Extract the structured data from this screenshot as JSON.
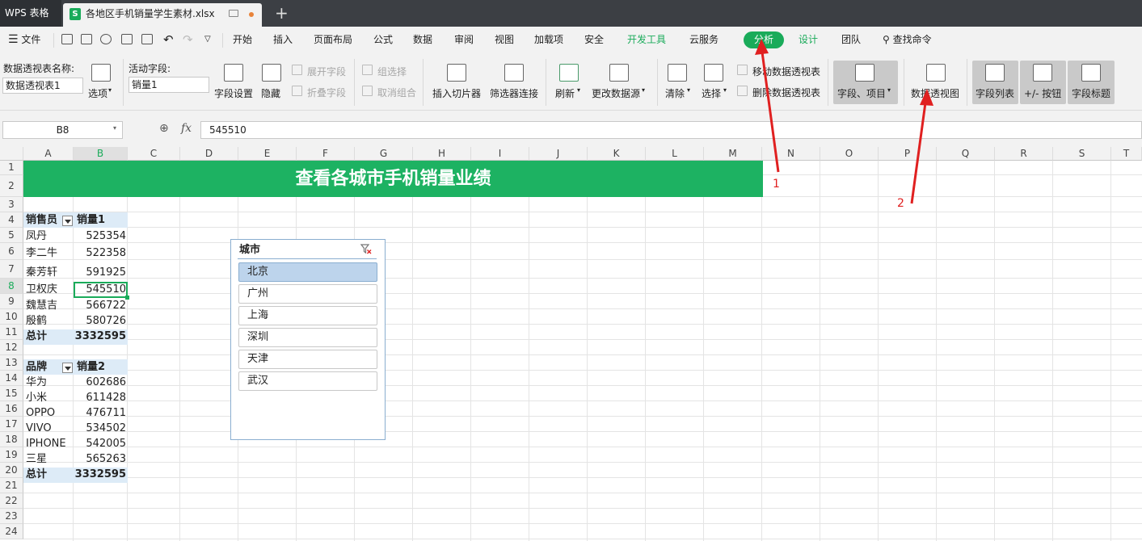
{
  "window": {
    "app_tab": "WPS 表格",
    "file_tab": "各地区手机销量学生素材.xlsx",
    "new_tab": "+"
  },
  "menu": {
    "file": "文件",
    "items": [
      "开始",
      "插入",
      "页面布局",
      "公式",
      "数据",
      "审阅",
      "视图",
      "加载项",
      "安全",
      "开发工具",
      "云服务",
      "分析",
      "设计",
      "团队"
    ],
    "active": "分析",
    "search": "查找命令"
  },
  "ribbon": {
    "pivot_name_label": "数据透视表名称:",
    "pivot_name_value": "数据透视表1",
    "options": "选项",
    "active_field_label": "活动字段:",
    "active_field_value": "销量1",
    "field_settings": "字段设置",
    "hide": "隐藏",
    "expand_field": "展开字段",
    "collapse_field": "折叠字段",
    "group_selection": "组选择",
    "ungroup": "取消组合",
    "insert_slicer": "插入切片器",
    "filter_connections": "筛选器连接",
    "refresh": "刷新",
    "change_source": "更改数据源",
    "clear": "清除",
    "select": "选择",
    "move_pivot": "移动数据透视表",
    "delete_pivot": "删除数据透视表",
    "fields_items": "字段、项目",
    "pivot_chart": "数据透视图",
    "field_list": "字段列表",
    "plus_minus_buttons": "+/- 按钮",
    "field_headers": "字段标题"
  },
  "formula_bar": {
    "name_box": "B8",
    "fx": "fx",
    "value": "545510"
  },
  "columns": [
    "A",
    "B",
    "C",
    "D",
    "E",
    "F",
    "G",
    "H",
    "I",
    "J",
    "K",
    "L",
    "M",
    "N",
    "O",
    "P",
    "Q",
    "R",
    "S",
    "T"
  ],
  "rows": [
    "1",
    "2",
    "3",
    "4",
    "5",
    "6",
    "7",
    "8",
    "9",
    "10",
    "11",
    "12",
    "13",
    "14",
    "15",
    "16",
    "17",
    "18",
    "19",
    "20",
    "21",
    "22",
    "23",
    "24"
  ],
  "sheet": {
    "title": "查看各城市手机销量业绩",
    "table1": {
      "header": [
        "销售员",
        "销量1"
      ],
      "rows": [
        [
          "凤丹",
          "525354"
        ],
        [
          "李二牛",
          "522358"
        ],
        [
          "秦芳轩",
          "591925"
        ],
        [
          "卫权庆",
          "545510"
        ],
        [
          "魏慧吉",
          "566722"
        ],
        [
          "殷鹤",
          "580726"
        ]
      ],
      "total": [
        "总计",
        "3332595"
      ]
    },
    "table2": {
      "header": [
        "品牌",
        "销量2"
      ],
      "rows": [
        [
          "华为",
          "602686"
        ],
        [
          "小米",
          "611428"
        ],
        [
          "OPPO",
          "476711"
        ],
        [
          "VIVO",
          "534502"
        ],
        [
          "IPHONE",
          "542005"
        ],
        [
          "三星",
          "565263"
        ]
      ],
      "total": [
        "总计",
        "3332595"
      ]
    }
  },
  "slicer": {
    "title": "城市",
    "items": [
      "北京",
      "广州",
      "上海",
      "深圳",
      "天津",
      "武汉"
    ],
    "selected": "北京"
  },
  "annotations": {
    "label1": "1",
    "label2": "2",
    "color": "#e02020"
  }
}
